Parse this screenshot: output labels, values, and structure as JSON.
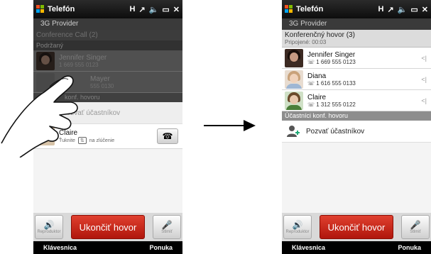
{
  "left": {
    "status_title": "Telefón",
    "provider": "3G Provider",
    "conference_title": "Conference Call (2)",
    "conference_status": "Podržaný",
    "callers": [
      {
        "name": "Jennifer Singer",
        "number": "1 669 555 0123"
      },
      {
        "name": "Mayer",
        "number": "555 0130"
      }
    ],
    "section_label": "konf. hovoru",
    "add_label": "Pozvať účastníkov",
    "incoming": {
      "name": "Claire",
      "hint_before": "Ťuknite",
      "hint_after": "na zlúčenie"
    },
    "speaker_label": "Reproduktor",
    "end_label": "Ukončiť hovor",
    "mute_label": "Stlmiť",
    "softkey_left": "Klávesnica",
    "softkey_right": "Ponuka"
  },
  "right": {
    "status_title": "Telefón",
    "provider": "3G Provider",
    "conference_title": "Konferenčný hovor (3)",
    "conference_status": "Pripojené: 00:03",
    "callers": [
      {
        "name": "Jennifer Singer",
        "number": "1 669 555 0123"
      },
      {
        "name": "Diana",
        "number": "1 616 555 0133"
      },
      {
        "name": "Claire",
        "number": "1 312 555 0122"
      }
    ],
    "section_label": "Účastníci konf. hovoru",
    "add_label": "Pozvať účastníkov",
    "speaker_label": "Reproduktor",
    "end_label": "Ukončiť hovor",
    "mute_label": "Stlmiť",
    "softkey_left": "Klávesnica",
    "softkey_right": "Ponuka"
  },
  "colors": {
    "end_call": "#c8261a",
    "status_bar": "#1a1a1a",
    "section": "#8d8d8d"
  }
}
